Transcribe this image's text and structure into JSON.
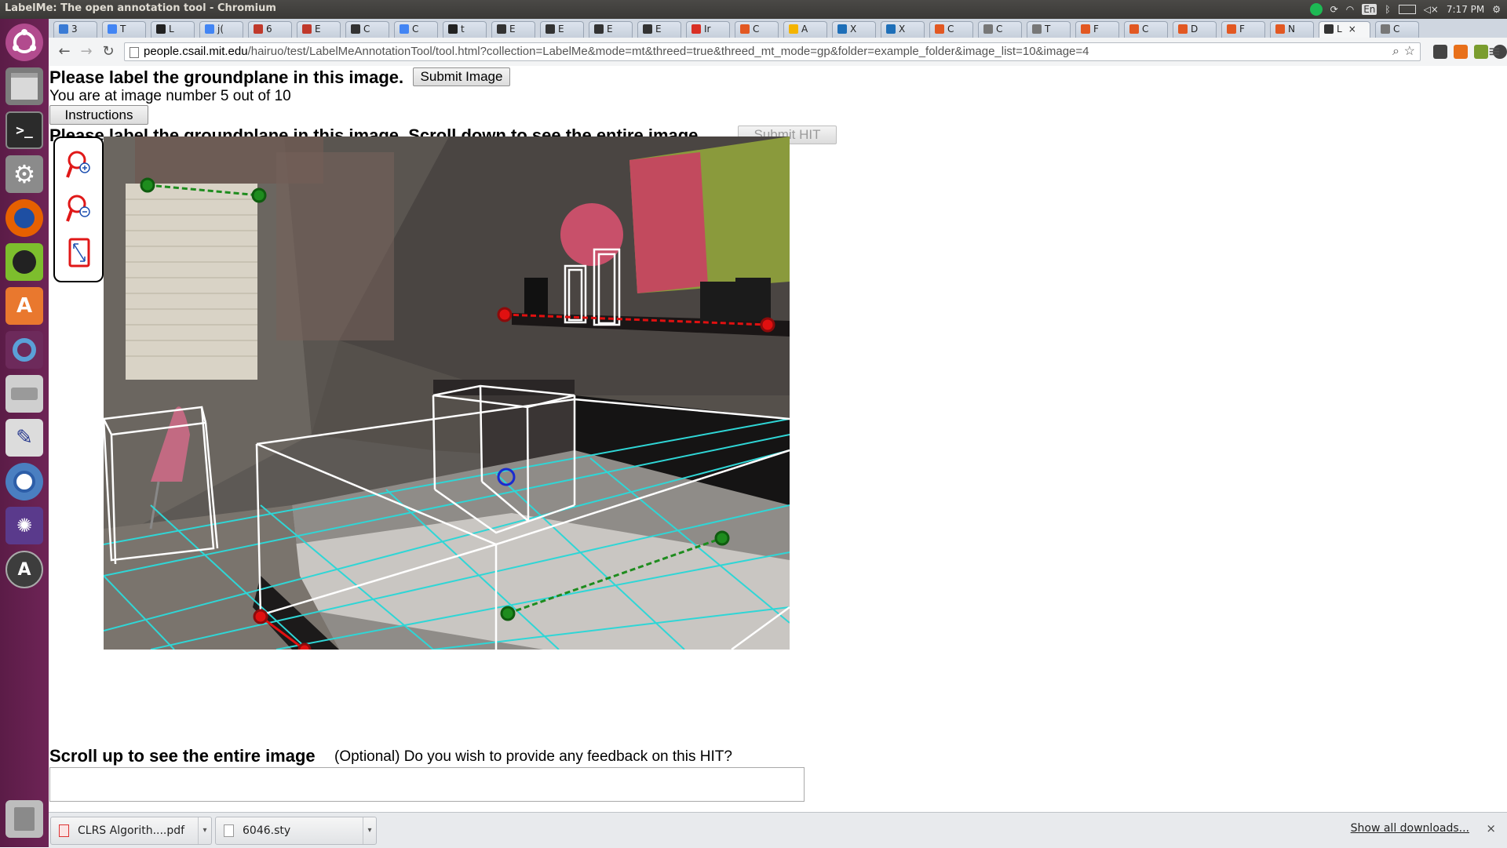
{
  "window": {
    "title": "LabelMe: The open annotation tool - Chromium",
    "clock": "7:17 PM",
    "keyboard_layout": "En"
  },
  "launcher": {
    "icons": [
      "ubuntu-logo-icon",
      "files-icon",
      "terminal-icon",
      "settings-icon",
      "firefox-icon",
      "spotify-icon",
      "software-center-icon",
      "app-icon",
      "drive-icon",
      "text-editor-icon",
      "chromium-icon",
      "shotwell-icon",
      "updater-icon",
      "trash-icon"
    ]
  },
  "tabs": [
    {
      "label": "3",
      "color": "#3a7bd5"
    },
    {
      "label": "T",
      "color": "#4285f4"
    },
    {
      "label": "L",
      "color": "#222222"
    },
    {
      "label": "j(",
      "color": "#4285f4"
    },
    {
      "label": "6",
      "color": "#c0392b"
    },
    {
      "label": "E",
      "color": "#c0392b"
    },
    {
      "label": "C",
      "color": "#333333"
    },
    {
      "label": "C",
      "color": "#4285f4"
    },
    {
      "label": "t",
      "color": "#222222"
    },
    {
      "label": "E",
      "color": "#333333"
    },
    {
      "label": "E",
      "color": "#333333"
    },
    {
      "label": "E",
      "color": "#333333"
    },
    {
      "label": "E",
      "color": "#333333"
    },
    {
      "label": "Ir",
      "color": "#d93025"
    },
    {
      "label": "C",
      "color": "#e25822"
    },
    {
      "label": "A",
      "color": "#f4b400"
    },
    {
      "label": "X",
      "color": "#1e6fb8"
    },
    {
      "label": "X",
      "color": "#1e6fb8"
    },
    {
      "label": "C",
      "color": "#e25822"
    },
    {
      "label": "C",
      "color": "#777777"
    },
    {
      "label": "T",
      "color": "#777777"
    },
    {
      "label": "F",
      "color": "#e25822"
    },
    {
      "label": "C",
      "color": "#e25822"
    },
    {
      "label": "D",
      "color": "#e25822"
    },
    {
      "label": "F",
      "color": "#e25822"
    },
    {
      "label": "N",
      "color": "#e25822"
    },
    {
      "label": "L",
      "color": "#333333",
      "active": true,
      "close": "×"
    },
    {
      "label": "C",
      "color": "#777777"
    }
  ],
  "toolbar": {
    "back": "←",
    "forward": "→",
    "reload": "↻",
    "url_host": "people.csail.mit.edu",
    "url_path": "/hairuo/test/LabelMeAnnotationTool/tool.html?collection=LabelMe&mode=mt&threed=true&threed_mt_mode=gp&folder=example_folder&image_list=10&image=4",
    "zoom_glyph": "⌕",
    "star_glyph": "☆",
    "menu_glyph": "≡"
  },
  "page": {
    "heading": "Please label the groundplane in this image.",
    "submit_image_label": "Submit Image",
    "progress_text": "You are at image number 5 out of 10",
    "instructions_label": "Instructions",
    "hidden_heading": "Please label the groundplane in this image. Scroll down to see the entire image.",
    "submit_hit_label": "Submit HIT",
    "scroll_up_text": "Scroll up to see the entire image",
    "feedback_prompt": "(Optional) Do you wish to provide any feedback on this HIT?",
    "feedback_value": ""
  },
  "annotation_tools": [
    "zoom-in-icon",
    "zoom-out-icon",
    "fit-to-screen-icon"
  ],
  "downloads": {
    "items": [
      {
        "name": "CLRS Algorith....pdf",
        "type": "pdf"
      },
      {
        "name": "6046.sty",
        "type": "file"
      }
    ],
    "show_all": "Show all downloads...",
    "close": "×"
  },
  "colors": {
    "grid": "#2fd6d6",
    "box": "#ffffff",
    "point_green": "#1e8c1e",
    "point_red": "#e01010",
    "point_blue": "#1a2bd0"
  }
}
